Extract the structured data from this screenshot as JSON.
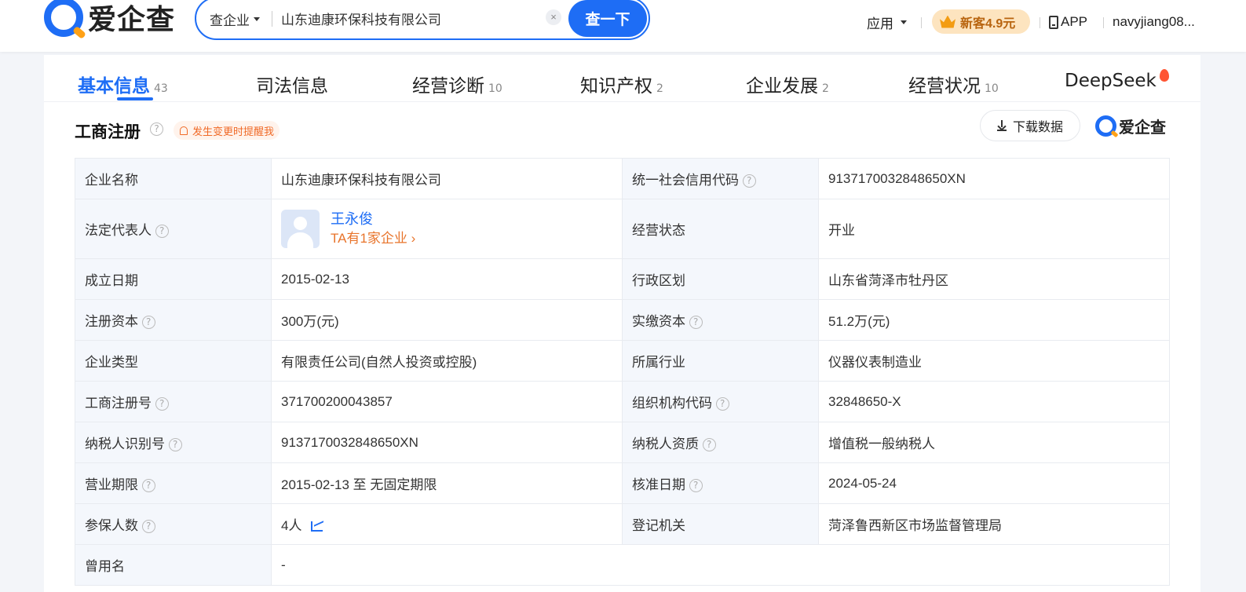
{
  "header": {
    "logo_text": "爱企查",
    "search": {
      "type_label": "查企业",
      "query": "山东迪康环保科技有限公司",
      "clear_glyph": "×",
      "button_label": "查一下"
    },
    "nav": {
      "apps_label": "应用",
      "promo_label": "新客4.9元",
      "app_label": "APP",
      "user_name": "navyjiang08..."
    }
  },
  "tabs": [
    {
      "label": "基本信息",
      "count": "43"
    },
    {
      "label": "司法信息",
      "count": ""
    },
    {
      "label": "经营诊断",
      "count": "10"
    },
    {
      "label": "知识产权",
      "count": "2"
    },
    {
      "label": "企业发展",
      "count": "2"
    },
    {
      "label": "经营状况",
      "count": "10"
    },
    {
      "label": "DeepSeek",
      "count": ""
    }
  ],
  "section": {
    "title": "工商注册",
    "help_glyph": "?",
    "remind_label": "发生变更时提醒我",
    "download_label": "下载数据",
    "brand_label": "爱企查"
  },
  "info": {
    "company_name_label": "企业名称",
    "company_name": "山东迪康环保科技有限公司",
    "credit_code_label": "统一社会信用代码",
    "credit_code": "9137170032848650XN",
    "legal_rep_label": "法定代表人",
    "legal_rep_name": "王永俊",
    "legal_rep_link": "TA有1家企业 ›",
    "status_label": "经营状态",
    "status": "开业",
    "founded_label": "成立日期",
    "founded": "2015-02-13",
    "region_label": "行政区划",
    "region": "山东省菏泽市牡丹区",
    "reg_capital_label": "注册资本",
    "reg_capital": "300万(元)",
    "paid_capital_label": "实缴资本",
    "paid_capital": "51.2万(元)",
    "company_type_label": "企业类型",
    "company_type": "有限责任公司(自然人投资或控股)",
    "industry_label": "所属行业",
    "industry": "仪器仪表制造业",
    "reg_no_label": "工商注册号",
    "reg_no": "371700200043857",
    "org_code_label": "组织机构代码",
    "org_code": "32848650-X",
    "taxpayer_id_label": "纳税人识别号",
    "taxpayer_id": "9137170032848650XN",
    "taxpayer_qual_label": "纳税人资质",
    "taxpayer_qual": "增值税一般纳税人",
    "term_label": "营业期限",
    "term": "2015-02-13 至 无固定期限",
    "approval_date_label": "核准日期",
    "approval_date": "2024-05-24",
    "insured_label": "参保人数",
    "insured": "4人",
    "authority_label": "登记机关",
    "authority": "菏泽鲁西新区市场监督管理局",
    "former_name_label": "曾用名",
    "former_name": "-"
  }
}
